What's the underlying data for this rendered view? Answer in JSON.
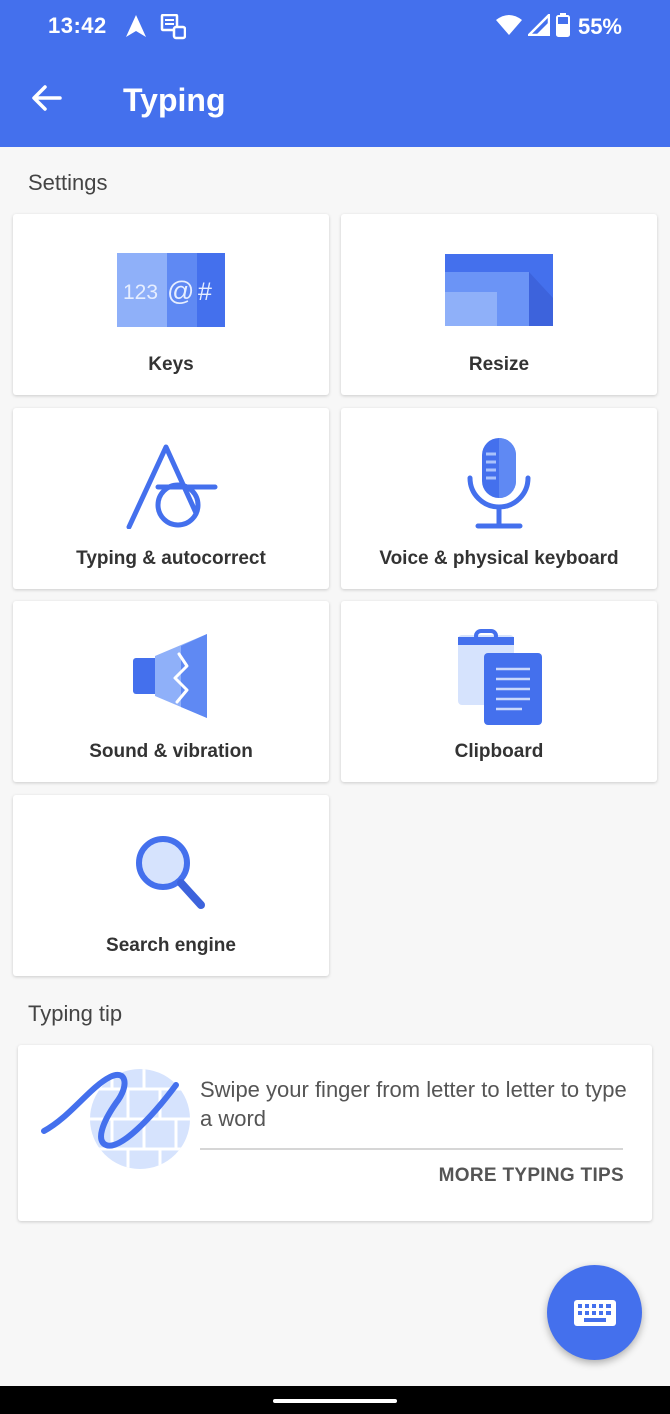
{
  "status_bar": {
    "time": "13:42",
    "battery_percent": "55%",
    "icons": [
      "navigation-icon",
      "message-sync-icon",
      "wifi-icon",
      "cell-signal-icon",
      "battery-icon"
    ]
  },
  "app_bar": {
    "title": "Typing",
    "back_icon": "arrow-back-icon",
    "color": "#4470ed"
  },
  "settings_section": {
    "heading": "Settings",
    "items": [
      {
        "label": "Keys",
        "icon": "keys-icon",
        "icon_text": [
          "123",
          "@",
          "#"
        ]
      },
      {
        "label": "Resize",
        "icon": "resize-icon"
      },
      {
        "label": "Typing & autocorrect",
        "icon": "typing-autocorrect-icon"
      },
      {
        "label": "Voice & physical keyboard",
        "icon": "microphone-icon"
      },
      {
        "label": "Sound & vibration",
        "icon": "speaker-icon"
      },
      {
        "label": "Clipboard",
        "icon": "clipboard-icon"
      },
      {
        "label": "Search engine",
        "icon": "search-icon"
      }
    ]
  },
  "tip_section": {
    "heading": "Typing tip",
    "text": "Swipe your finger from letter to letter to type a word",
    "link_label": "MORE TYPING TIPS",
    "icon": "swipe-typing-icon"
  },
  "fab": {
    "icon": "keyboard-icon"
  },
  "colors": {
    "accent": "#4470ed",
    "light_accent": "#8fb0f9",
    "pale_accent": "#d6e3fd",
    "background": "#f7f7f7"
  }
}
